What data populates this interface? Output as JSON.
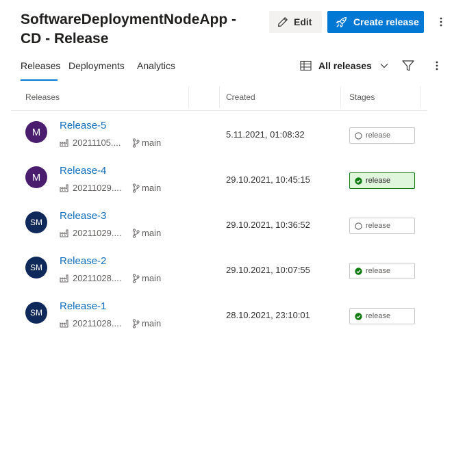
{
  "header": {
    "title": "SoftwareDeploymentNodeApp - CD - Release",
    "edit_label": "Edit",
    "create_label": "Create release"
  },
  "tabs": [
    {
      "label": "Releases",
      "active": true
    },
    {
      "label": "Deployments",
      "active": false
    },
    {
      "label": "Analytics",
      "active": false
    }
  ],
  "view_filter": {
    "label": "All releases"
  },
  "columns": {
    "releases": "Releases",
    "created": "Created",
    "stages": "Stages"
  },
  "colors": {
    "accent": "#0078d4",
    "link": "#106ebe",
    "success": "#107c10",
    "avatar_m": "#4b1d6e",
    "avatar_sm": "#10295b"
  },
  "releases": [
    {
      "name": "Release-5",
      "avatar": "M",
      "build": "20211105....",
      "branch": "main",
      "created": "5.11.2021, 01:08:32",
      "stage": {
        "label": "release",
        "status": "not-deployed"
      }
    },
    {
      "name": "Release-4",
      "avatar": "M",
      "build": "20211029....",
      "branch": "main",
      "created": "29.10.2021, 10:45:15",
      "stage": {
        "label": "release",
        "status": "succeeded-current"
      }
    },
    {
      "name": "Release-3",
      "avatar": "SM",
      "build": "20211029....",
      "branch": "main",
      "created": "29.10.2021, 10:36:52",
      "stage": {
        "label": "release",
        "status": "not-deployed"
      }
    },
    {
      "name": "Release-2",
      "avatar": "SM",
      "build": "20211028....",
      "branch": "main",
      "created": "29.10.2021, 10:07:55",
      "stage": {
        "label": "release",
        "status": "succeeded"
      }
    },
    {
      "name": "Release-1",
      "avatar": "SM",
      "build": "20211028....",
      "branch": "main",
      "created": "28.10.2021, 23:10:01",
      "stage": {
        "label": "release",
        "status": "succeeded"
      }
    }
  ]
}
